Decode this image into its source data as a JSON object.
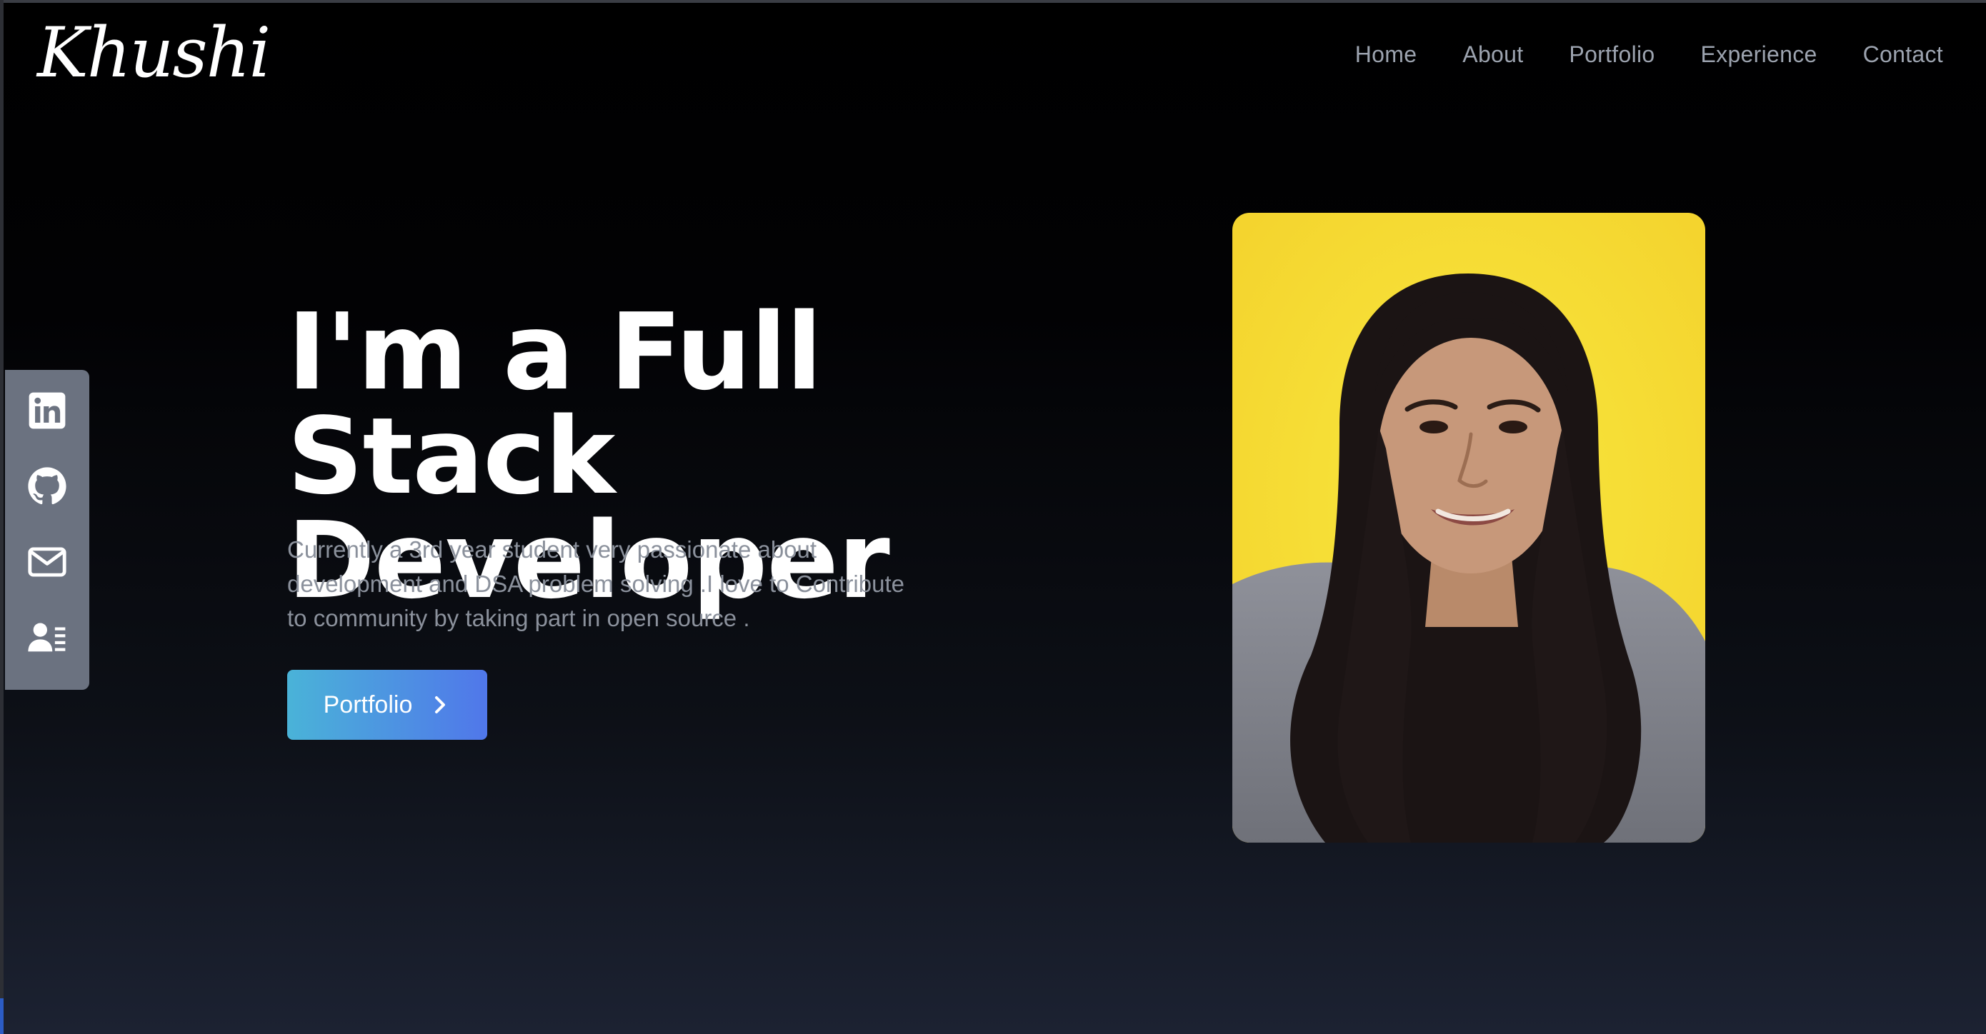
{
  "brand": {
    "logo_text": "Khushi"
  },
  "nav": {
    "items": [
      {
        "label": "Home"
      },
      {
        "label": "About"
      },
      {
        "label": "Portfolio"
      },
      {
        "label": "Experience"
      },
      {
        "label": "Contact"
      }
    ]
  },
  "social": {
    "items": [
      {
        "icon": "linkedin-icon"
      },
      {
        "icon": "github-icon"
      },
      {
        "icon": "mail-icon"
      },
      {
        "icon": "resume-icon"
      }
    ]
  },
  "hero": {
    "title_line1": "I'm a Full Stack",
    "title_line2": "Developer",
    "description": "Currently a 3rd year student very passionate about development and DSA problem solving .I love to Contribute to community by taking part in open source .",
    "cta_label": "Portfolio"
  },
  "colors": {
    "background_top": "#000000",
    "background_bottom": "#1c2232",
    "sidebar": "#6b7280",
    "nav_text": "#9ca3af",
    "cta_gradient_start": "#4ab3d8",
    "cta_gradient_end": "#5077ea",
    "portrait_bg": "#f6df3a"
  }
}
